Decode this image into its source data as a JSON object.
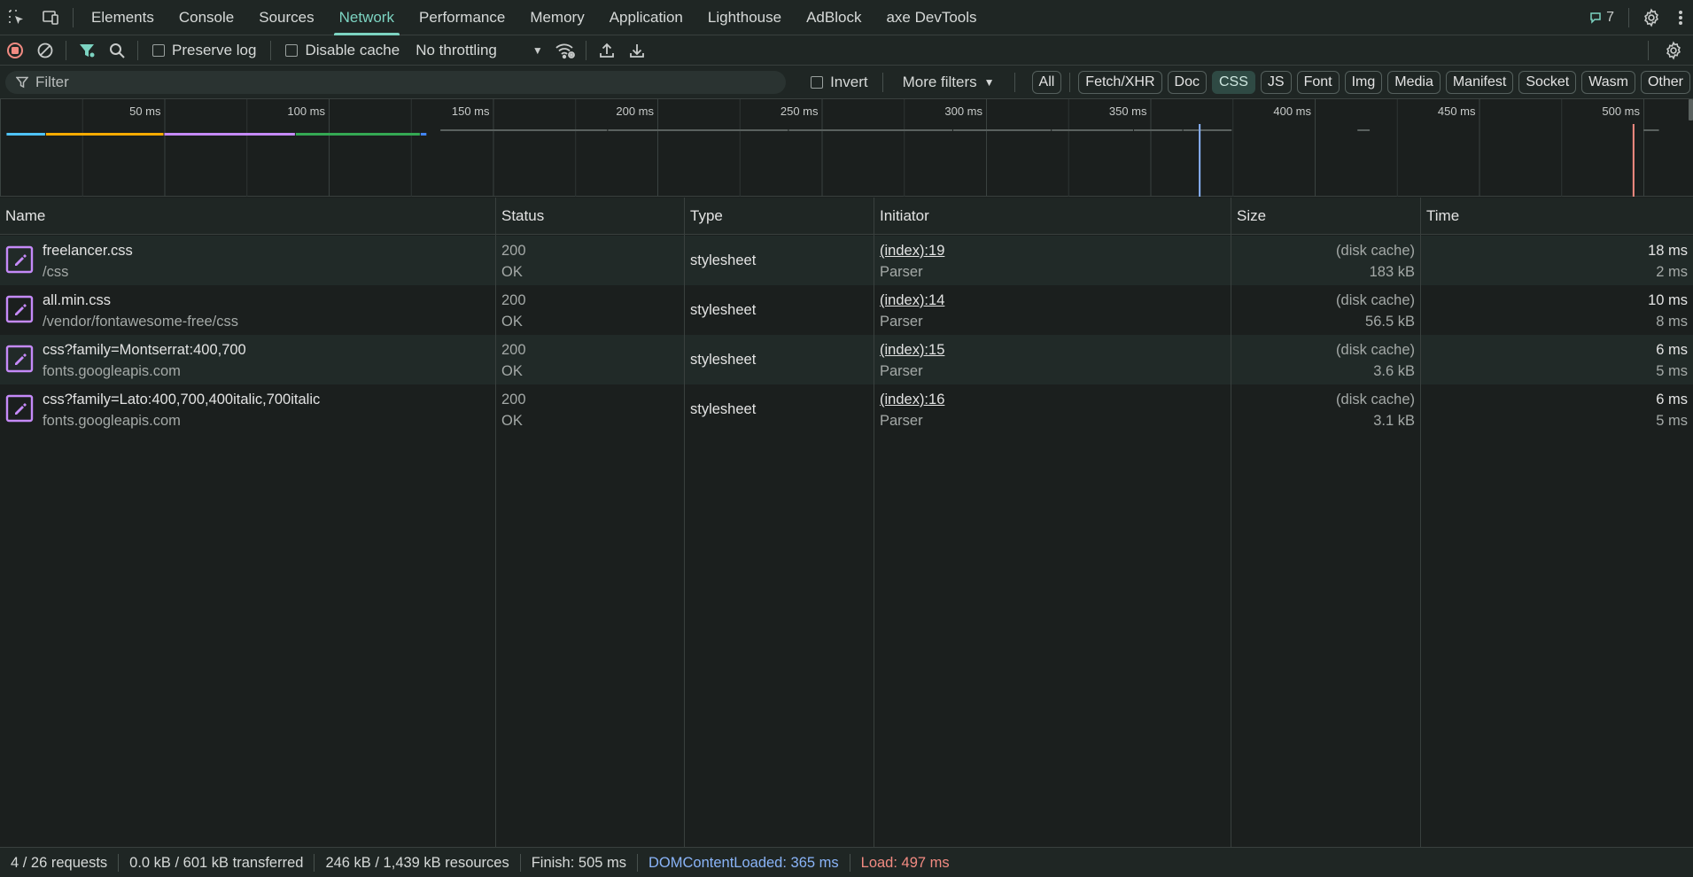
{
  "tabbar": {
    "tabs": [
      "Elements",
      "Console",
      "Sources",
      "Network",
      "Performance",
      "Memory",
      "Application",
      "Lighthouse",
      "AdBlock",
      "axe DevTools"
    ],
    "active_tab": "Network",
    "issues_count": "7"
  },
  "toolbar": {
    "preserve_log": "Preserve log",
    "disable_cache": "Disable cache",
    "throttling": "No throttling"
  },
  "filter": {
    "placeholder": "Filter",
    "invert": "Invert",
    "more_filters": "More filters",
    "types": [
      "All",
      "Fetch/XHR",
      "Doc",
      "CSS",
      "JS",
      "Font",
      "Img",
      "Media",
      "Manifest",
      "Socket",
      "Wasm",
      "Other"
    ],
    "active_type": "CSS"
  },
  "overview": {
    "ticks": [
      "50 ms",
      "100 ms",
      "150 ms",
      "200 ms",
      "250 ms",
      "300 ms",
      "350 ms",
      "400 ms",
      "450 ms",
      "500 ms"
    ],
    "tick_values_ms": [
      50,
      100,
      150,
      200,
      250,
      300,
      350,
      400,
      450,
      500
    ],
    "dom_content_loaded_ms": 365,
    "load_ms": 497,
    "colors": {
      "dcl_line": "#8ab4f8",
      "load_line": "#f28b82",
      "bars": [
        "#4fc3f7",
        "#f9ab00",
        "#c58af9",
        "#34a853",
        "#4285f4"
      ]
    }
  },
  "table": {
    "headers": {
      "name": "Name",
      "status": "Status",
      "type": "Type",
      "initiator": "Initiator",
      "size": "Size",
      "time": "Time"
    },
    "rows": [
      {
        "name": "freelancer.css",
        "path": "/css",
        "status": "200",
        "status_text": "OK",
        "type": "stylesheet",
        "initiator": "(index):19",
        "initiator_type": "Parser",
        "size": "(disk cache)",
        "resource_size": "183 kB",
        "time": "18 ms",
        "latency": "2 ms",
        "icon": "stylesheet-icon"
      },
      {
        "name": "all.min.css",
        "path": "/vendor/fontawesome-free/css",
        "status": "200",
        "status_text": "OK",
        "type": "stylesheet",
        "initiator": "(index):14",
        "initiator_type": "Parser",
        "size": "(disk cache)",
        "resource_size": "56.5 kB",
        "time": "10 ms",
        "latency": "8 ms",
        "icon": "stylesheet-icon"
      },
      {
        "name": "css?family=Montserrat:400,700",
        "path": "fonts.googleapis.com",
        "status": "200",
        "status_text": "OK",
        "type": "stylesheet",
        "initiator": "(index):15",
        "initiator_type": "Parser",
        "size": "(disk cache)",
        "resource_size": "3.6 kB",
        "time": "6 ms",
        "latency": "5 ms",
        "icon": "stylesheet-icon"
      },
      {
        "name": "css?family=Lato:400,700,400italic,700italic",
        "path": "fonts.googleapis.com",
        "status": "200",
        "status_text": "OK",
        "type": "stylesheet",
        "initiator": "(index):16",
        "initiator_type": "Parser",
        "size": "(disk cache)",
        "resource_size": "3.1 kB",
        "time": "6 ms",
        "latency": "5 ms",
        "icon": "stylesheet-icon"
      }
    ]
  },
  "statusbar": {
    "requests": "4 / 26 requests",
    "transferred": "0.0 kB / 601 kB transferred",
    "resources": "246 kB / 1,439 kB resources",
    "finish": "Finish: 505 ms",
    "dcl": "DOMContentLoaded: 365 ms",
    "load": "Load: 497 ms"
  }
}
